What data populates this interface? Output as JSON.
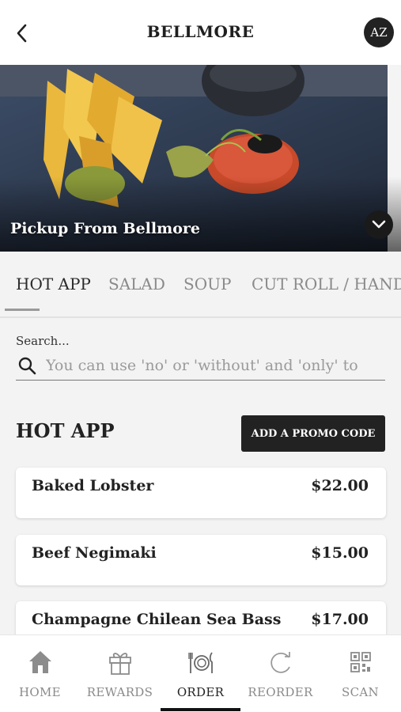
{
  "header": {
    "title": "BELLMORE",
    "avatar_initials": "AZ",
    "back_icon": "chevron-left-icon"
  },
  "hero": {
    "pickup_text": "Pickup From Bellmore",
    "expand_icon": "chevron-down-icon"
  },
  "tabs": [
    {
      "label": "HOT APP",
      "active": true
    },
    {
      "label": "SALAD",
      "active": false
    },
    {
      "label": "SOUP",
      "active": false
    },
    {
      "label": "CUT ROLL / HAND ROLL",
      "active": false
    }
  ],
  "search": {
    "label": "Search...",
    "placeholder": "You can use 'no' or 'without' and 'only' to filter"
  },
  "section": {
    "title": "HOT APP",
    "promo_button": "ADD A PROMO CODE"
  },
  "menu_items": [
    {
      "name": "Baked Lobster",
      "price": "$22.00"
    },
    {
      "name": "Beef Negimaki",
      "price": "$15.00"
    },
    {
      "name": "Champagne Chilean Sea Bass",
      "price": "$17.00"
    }
  ],
  "bottom_nav": [
    {
      "label": "HOME",
      "icon": "home-icon",
      "active": false
    },
    {
      "label": "REWARDS",
      "icon": "gift-icon",
      "active": false
    },
    {
      "label": "ORDER",
      "icon": "dining-icon",
      "active": true
    },
    {
      "label": "REORDER",
      "icon": "reorder-icon",
      "active": false
    },
    {
      "label": "SCAN",
      "icon": "qr-code-icon",
      "active": false
    }
  ],
  "colors": {
    "accent": "#222222",
    "background": "#f3f3f3",
    "muted_text": "#8a8a8a"
  }
}
